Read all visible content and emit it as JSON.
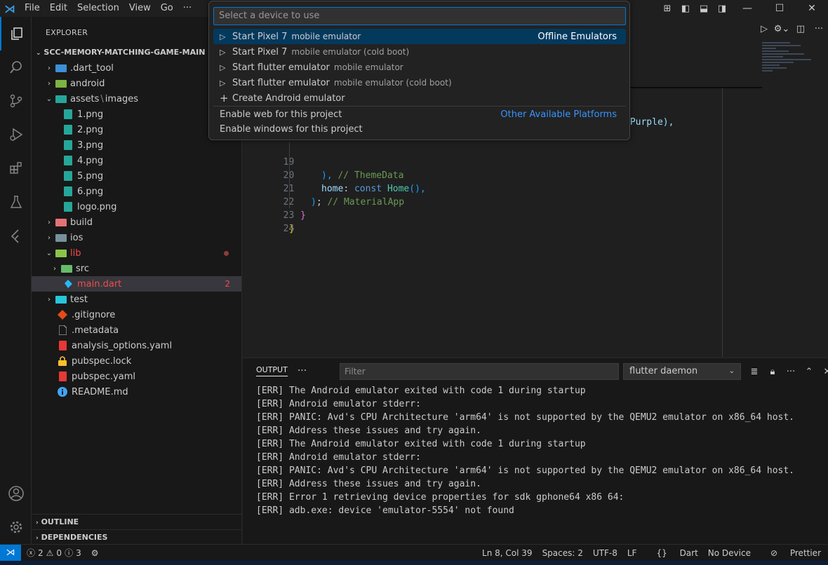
{
  "menu": [
    "File",
    "Edit",
    "Selection",
    "View",
    "Go",
    "···"
  ],
  "quick_pick": {
    "placeholder": "Select a device to use",
    "items": [
      {
        "label": "Start Pixel 7",
        "desc": "mobile emulator",
        "group": "Offline Emulators"
      },
      {
        "label": "Start Pixel 7",
        "desc": "mobile emulator (cold boot)"
      },
      {
        "label": "Start flutter emulator",
        "desc": "mobile emulator"
      },
      {
        "label": "Start flutter emulator",
        "desc": "mobile emulator (cold boot)"
      },
      {
        "label": "Create Android emulator"
      }
    ],
    "platform_items": [
      {
        "label": "Enable web for this project",
        "group": "Other Available Platforms"
      },
      {
        "label": "Enable windows for this project"
      }
    ]
  },
  "explorer": {
    "title": "EXPLORER",
    "root": "SCC-MEMORY-MATCHING-GAME-MAIN",
    "items": [
      {
        "label": ".dart_tool"
      },
      {
        "label": "android"
      },
      {
        "label": "assets",
        "sep": "\\",
        "label2": "images"
      },
      {
        "label": "1.png"
      },
      {
        "label": "2.png"
      },
      {
        "label": "3.png"
      },
      {
        "label": "4.png"
      },
      {
        "label": "5.png"
      },
      {
        "label": "6.png"
      },
      {
        "label": "logo.png"
      },
      {
        "label": "build"
      },
      {
        "label": "ios"
      },
      {
        "label": "lib"
      },
      {
        "label": "src"
      },
      {
        "label": "main.dart",
        "badge": "2"
      },
      {
        "label": "test"
      },
      {
        "label": ".gitignore"
      },
      {
        "label": ".metadata"
      },
      {
        "label": "analysis_options.yaml"
      },
      {
        "label": "pubspec.lock"
      },
      {
        "label": "pubspec.yaml"
      },
      {
        "label": "README.md"
      }
    ],
    "outline": "OUTLINE",
    "dependencies": "DEPENDENCIES"
  },
  "editor": {
    "partial_line": "pPurple),",
    "lines": [
      {
        "n": "19",
        "parts": [
          "), ",
          "// ThemeData"
        ]
      },
      {
        "n": "20",
        "parts": [
          "home",
          ": ",
          "const",
          " ",
          "Home",
          "(),"
        ]
      },
      {
        "n": "21",
        "parts": [
          ")",
          "; ",
          "// MaterialApp"
        ]
      },
      {
        "n": "22",
        "parts": [
          "}"
        ]
      },
      {
        "n": "23",
        "parts": [
          "}"
        ]
      },
      {
        "n": "24",
        "parts": [
          ""
        ]
      }
    ]
  },
  "panel": {
    "tab": "OUTPUT",
    "more": "···",
    "filter_placeholder": "Filter",
    "channel": "flutter daemon",
    "lines": [
      "[ERR] The Android emulator exited with code 1 during startup",
      "[ERR] Android emulator stderr:",
      "[ERR] PANIC: Avd's CPU Architecture 'arm64' is not supported by the QEMU2 emulator on x86_64 host.",
      "[ERR] Address these issues and try again.",
      "[ERR] The Android emulator exited with code 1 during startup",
      "[ERR] Android emulator stderr:",
      "[ERR] PANIC: Avd's CPU Architecture 'arm64' is not supported by the QEMU2 emulator on x86_64 host.",
      "[ERR] Address these issues and try again.",
      "[ERR] Error 1 retrieving device properties for sdk gphone64 x86 64:",
      "[ERR] adb.exe: device 'emulator-5554' not found"
    ]
  },
  "status": {
    "errors": "2",
    "warnings": "0",
    "info": "3",
    "position": "Ln 8, Col 39",
    "spaces": "Spaces: 2",
    "encoding": "UTF-8",
    "eol": "LF",
    "language": "Dart",
    "device": "No Device",
    "formatter": "Prettier"
  },
  "colors": {
    "accent": "#0078d4",
    "error": "#f14c4c",
    "link": "#3794ff"
  }
}
